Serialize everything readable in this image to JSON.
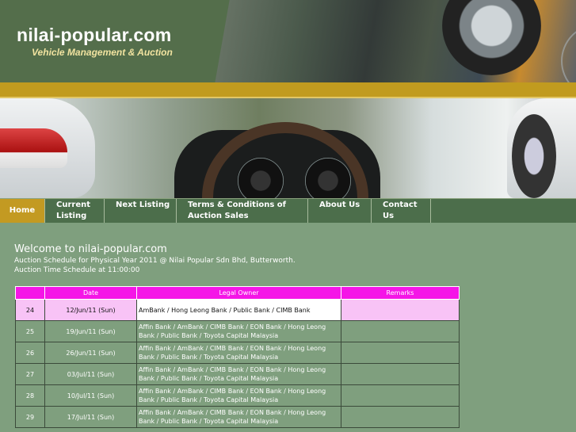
{
  "header": {
    "site_title": "nilai-popular.com",
    "tagline": "Vehicle Management & Auction"
  },
  "nav": [
    {
      "label": "Home",
      "active": true
    },
    {
      "label": "Current Listing",
      "active": false
    },
    {
      "label": "Next Listing",
      "active": false
    },
    {
      "label": "Terms & Conditions of Auction Sales",
      "active": false
    },
    {
      "label": "About Us",
      "active": false
    },
    {
      "label": "Contact Us",
      "active": false
    }
  ],
  "content": {
    "welcome": "Welcome to nilai-popular.com",
    "schedule_line": "Auction Schedule for Physical Year 2011 @ Nilai Popular Sdn Bhd, Butterworth.",
    "time_line": "Auction Time Schedule at 11:00:00"
  },
  "table": {
    "headers": [
      "",
      "Date",
      "Legal Owner",
      "Remarks"
    ],
    "rows": [
      {
        "no": "24",
        "date": "12/Jun/11 (Sun)",
        "owner": "AmBank / Hong Leong Bank / Public Bank / CIMB Bank",
        "remarks": "",
        "highlight": true
      },
      {
        "no": "25",
        "date": "19/Jun/11 (Sun)",
        "owner": "Affin Bank / AmBank / CIMB Bank / EON Bank / Hong Leong Bank / Public Bank / Toyota Capital Malaysia",
        "remarks": ""
      },
      {
        "no": "26",
        "date": "26/Jun/11 (Sun)",
        "owner": "Affin Bank / AmBank / CIMB Bank / EON Bank / Hong Leong Bank / Public Bank / Toyota Capital Malaysia",
        "remarks": ""
      },
      {
        "no": "27",
        "date": "03/Jul/11 (Sun)",
        "owner": "Affin Bank / AmBank / CIMB Bank / EON Bank / Hong Leong Bank / Public Bank / Toyota Capital Malaysia",
        "remarks": ""
      },
      {
        "no": "28",
        "date": "10/Jul/11 (Sun)",
        "owner": "Affin Bank / AmBank / CIMB Bank / EON Bank / Hong Leong Bank / Public Bank / Toyota Capital Malaysia",
        "remarks": ""
      },
      {
        "no": "29",
        "date": "17/Jul/11 (Sun)",
        "owner": "Affin Bank / AmBank / CIMB Bank / EON Bank / Hong Leong Bank / Public Bank / Toyota Capital Malaysia",
        "remarks": ""
      }
    ]
  },
  "colors": {
    "background": "#7f9f7e",
    "nav_active": "#c39a22",
    "table_header": "#f515e7",
    "highlight_row": "#f8c3f6"
  }
}
